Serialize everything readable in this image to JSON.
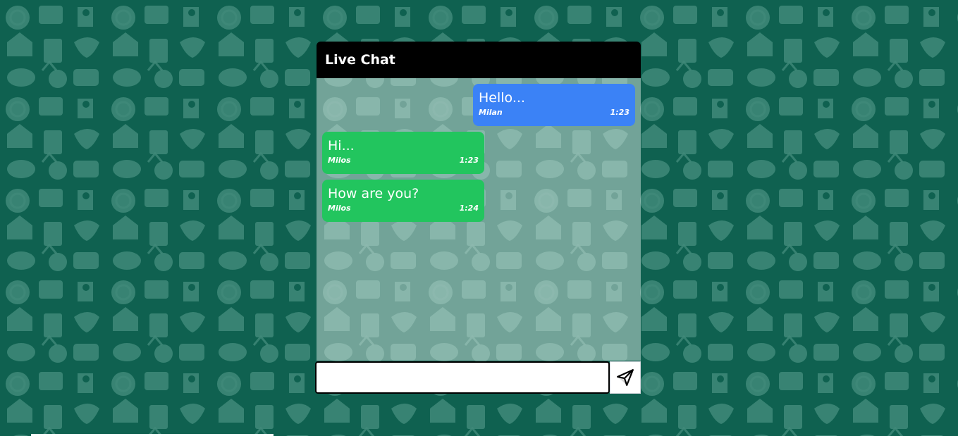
{
  "window": {
    "title": "Live Chat"
  },
  "messages": [
    {
      "direction": "outgoing",
      "text": "Hello...",
      "author": "Milan",
      "time": "1:23"
    },
    {
      "direction": "incoming",
      "text": "Hi...",
      "author": "Milos",
      "time": "1:23"
    },
    {
      "direction": "incoming",
      "text": "How are you?",
      "author": "Milos",
      "time": "1:24"
    }
  ],
  "composer": {
    "value": "",
    "placeholder": "",
    "send_icon": "paper-plane-icon"
  },
  "colors": {
    "header": "#000000",
    "outgoing_bubble": "#3b82f6",
    "incoming_bubble": "#22c55e",
    "wallpaper": "#0d5c4d"
  }
}
